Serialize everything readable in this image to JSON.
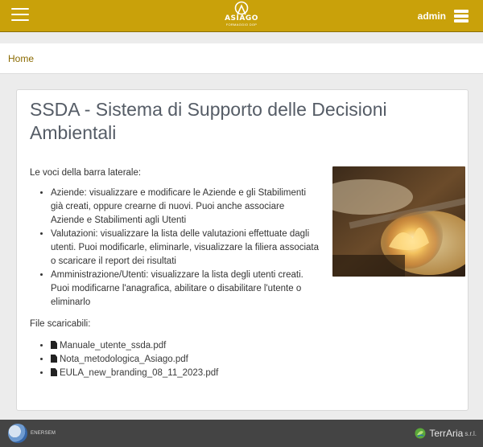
{
  "header": {
    "logo": {
      "word": "ASIAGO",
      "sub": "FORMAGGIO DOP"
    },
    "user": {
      "name": "admin",
      "menu_icon": "server-icon"
    },
    "menu_icon": "hamburger-icon",
    "colors": {
      "bar": "#c9a10a"
    }
  },
  "breadcrumb": {
    "home": "Home"
  },
  "main": {
    "title": "SSDA - Sistema di Supporto delle Decisioni Ambientali",
    "intro": "Le voci della barra laterale:",
    "items": [
      "Aziende: visualizzare e modificare le Aziende e gli Stabilimenti già creati, oppure crearne di nuovi. Puoi anche associare Aziende e Stabilimenti agli Utenti",
      "Valutazioni: visualizzare la lista delle valutazioni effettuate dagli utenti. Puoi modificarle, eliminarle, visualizzare la filiera associata o scaricare il report dei risultati",
      "Amministrazione/Utenti: visualizzare la lista degli utenti creati. Puoi modificarne l'anagrafica, abilitare o disabilitare l'utente o eliminarlo"
    ],
    "files_title": "File scaricabili:",
    "files": [
      "Manuale_utente_ssda.pdf",
      "Nota_metodologica_Asiago.pdf",
      "EULA_new_branding_08_11_2023.pdf"
    ],
    "file_icon": "pdf-icon"
  },
  "footer": {
    "left_logo": "ENERSEM",
    "right_logo": "TerrAria",
    "right_suffix": "s.r.l."
  }
}
